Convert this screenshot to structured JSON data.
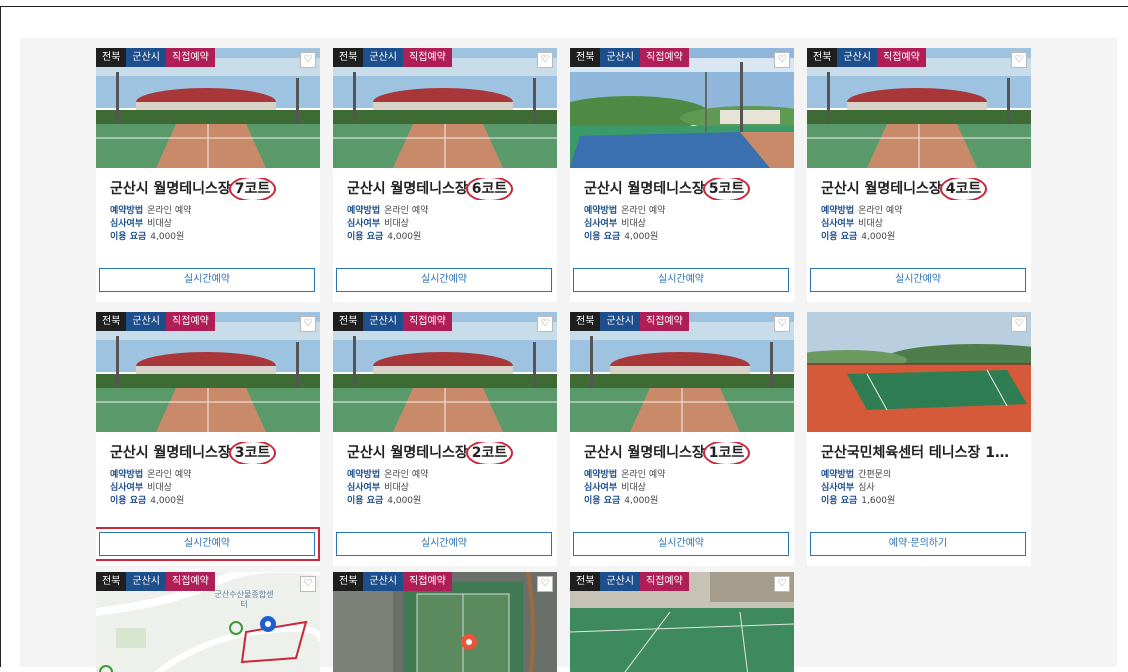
{
  "badges": {
    "region": "전북",
    "city": "군산시",
    "type": "직접예약"
  },
  "labels": {
    "method": "예약방법",
    "review": "심사여부",
    "fee": "이용 요금"
  },
  "cards": [
    {
      "title_main": "군산시 월명테니스장",
      "title_mark": "7코트",
      "method": "온라인 예약",
      "review": "비대상",
      "fee": "4,000원",
      "button": "실시간예약"
    },
    {
      "title_main": "군산시 월명테니스장",
      "title_mark": "6코트",
      "method": "온라인 예약",
      "review": "비대상",
      "fee": "4,000원",
      "button": "실시간예약"
    },
    {
      "title_main": "군산시 월명테니스장",
      "title_mark": "5코트",
      "method": "온라인 예약",
      "review": "비대상",
      "fee": "4,000원",
      "button": "실시간예약"
    },
    {
      "title_main": "군산시 월명테니스장",
      "title_mark": "4코트",
      "method": "온라인 예약",
      "review": "비대상",
      "fee": "4,000원",
      "button": "실시간예약"
    },
    {
      "title_main": "군산시 월명테니스장",
      "title_mark": "3코트",
      "method": "온라인 예약",
      "review": "비대상",
      "fee": "4,000원",
      "button": "실시간예약"
    },
    {
      "title_main": "군산시 월명테니스장",
      "title_mark": "2코트",
      "method": "온라인 예약",
      "review": "비대상",
      "fee": "4,000원",
      "button": "실시간예약"
    },
    {
      "title_main": "군산시 월명테니스장",
      "title_mark": "1코트",
      "method": "온라인 예약",
      "review": "비대상",
      "fee": "4,000원",
      "button": "실시간예약"
    },
    {
      "title_main": "군산국민체육센터 테니스장 1…",
      "title_mark": "",
      "method": "간편문의",
      "review": "심사",
      "fee": "1,600원",
      "button": "예약·문의하기"
    }
  ],
  "map_labels": {
    "map1": "군산수산물종합센터"
  },
  "colors": {
    "accent": "#2b73b7",
    "highlight": "#d0283a",
    "badge_type": "#b01e58",
    "badge_city": "#1d4f8c"
  }
}
